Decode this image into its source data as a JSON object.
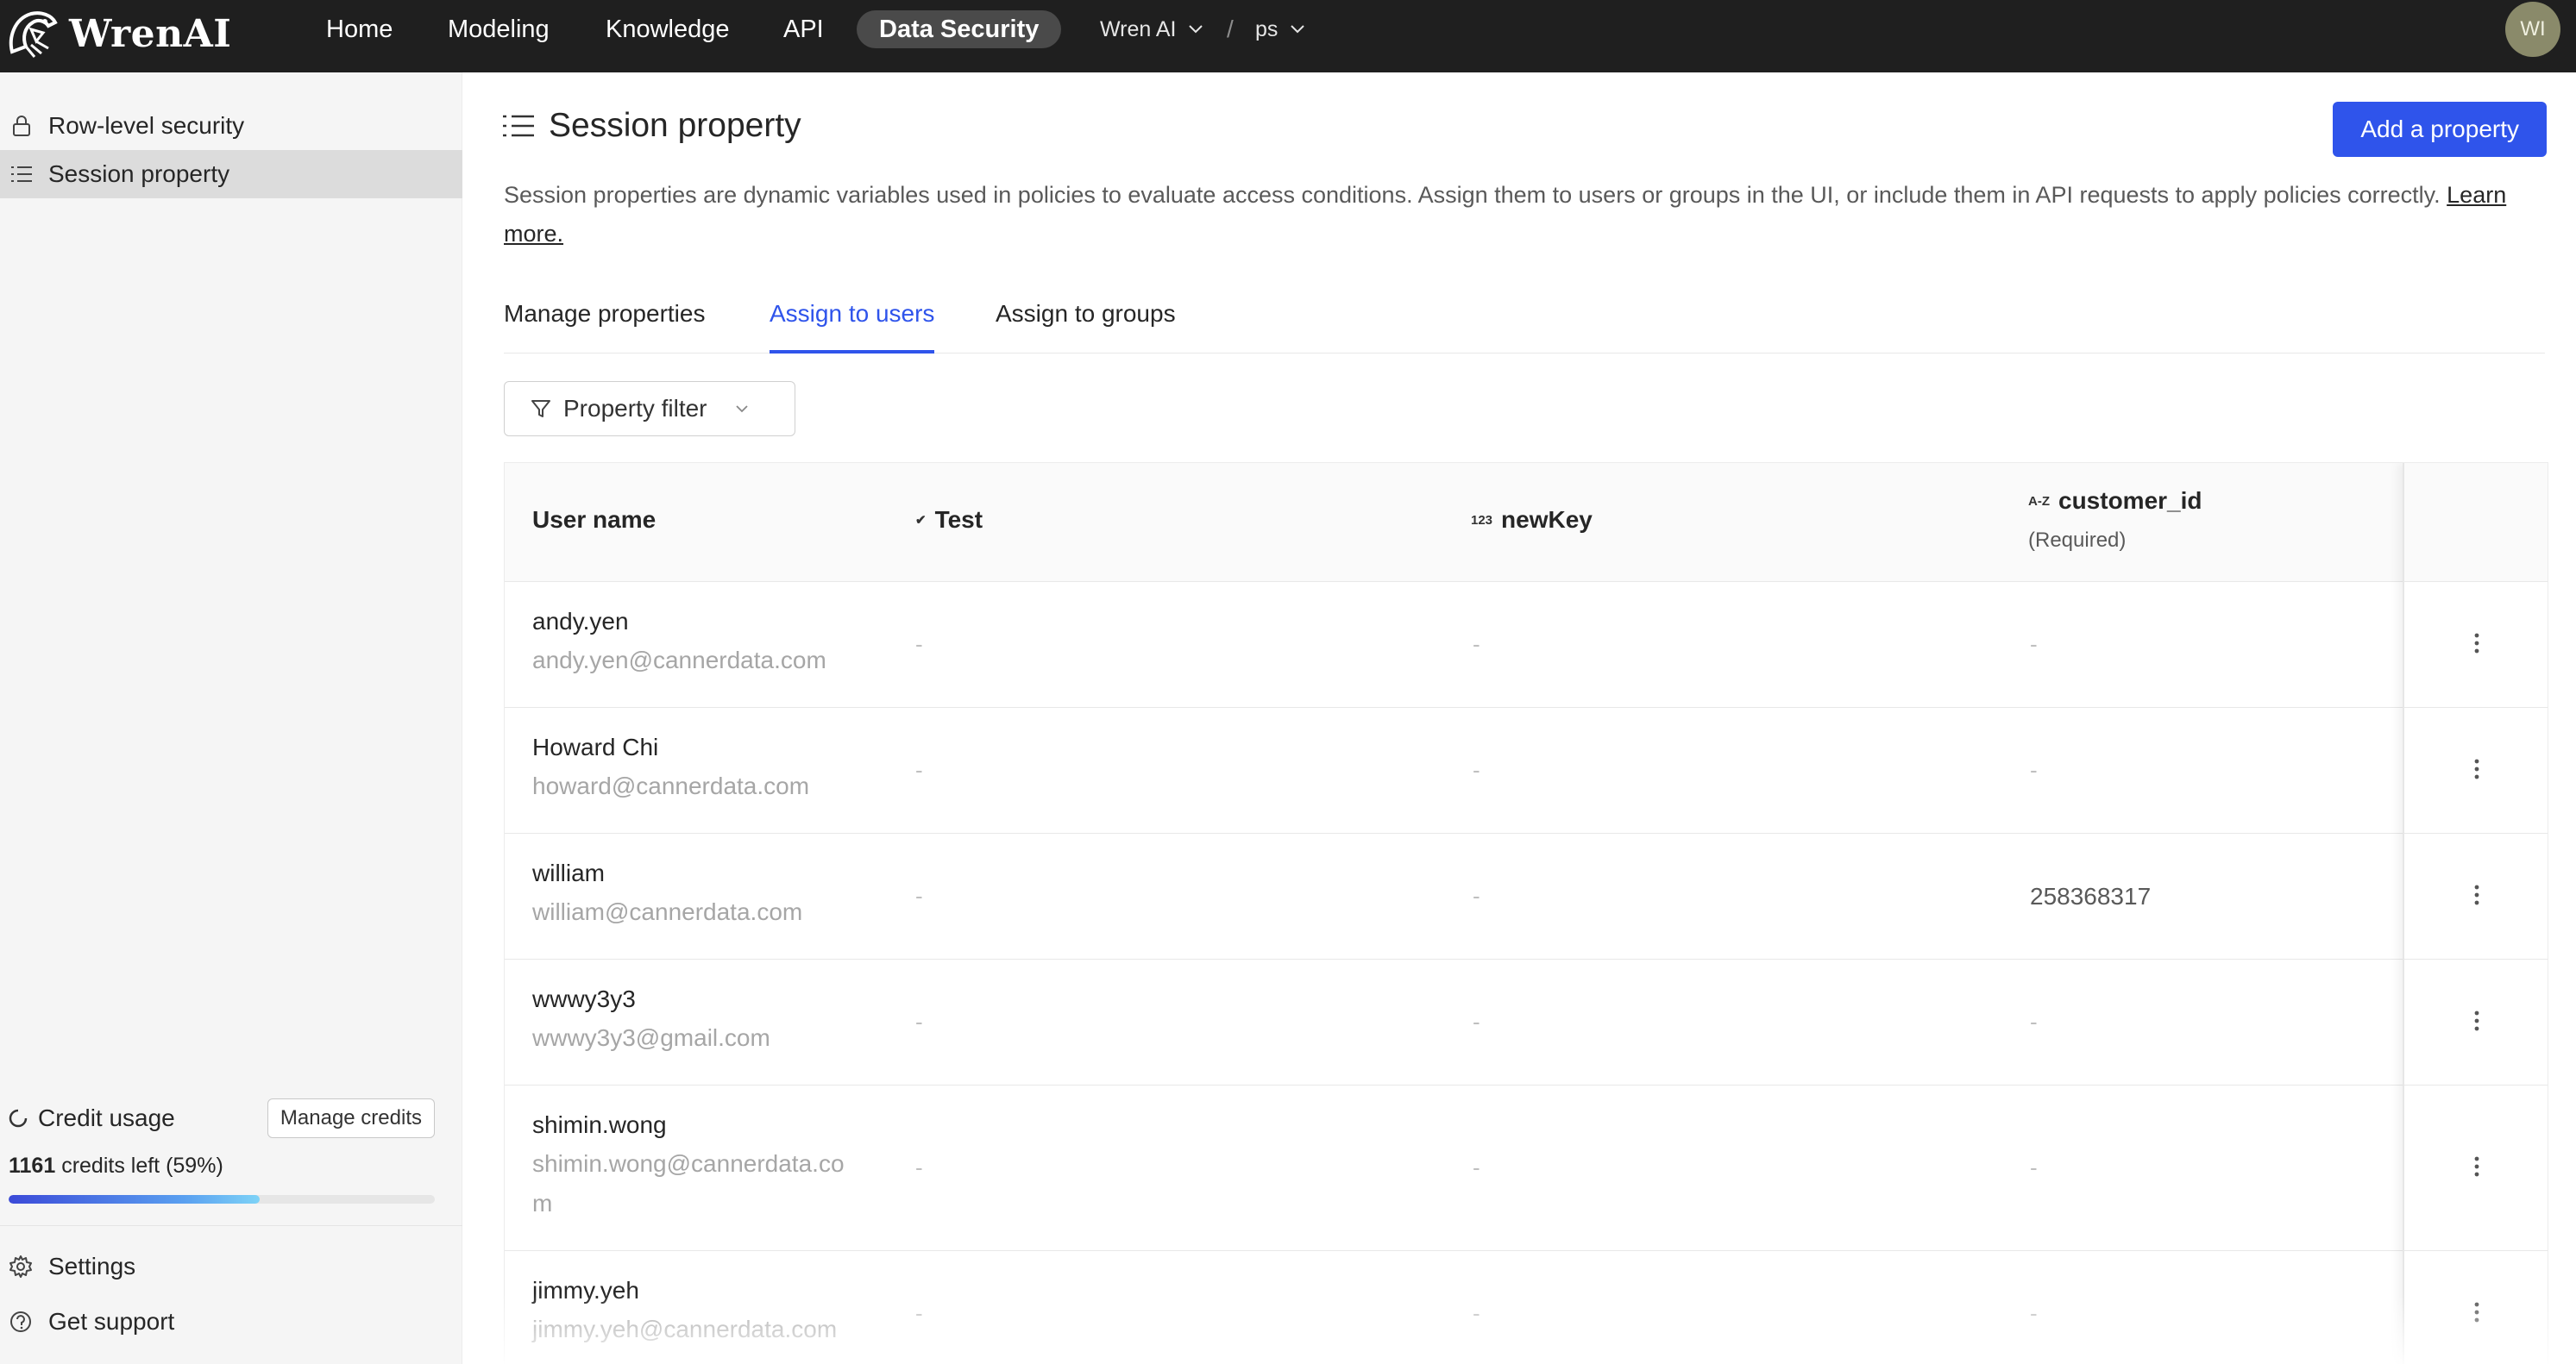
{
  "topbar": {
    "brand": "WrenAI",
    "nav": [
      "Home",
      "Modeling",
      "Knowledge",
      "API",
      "Data Security"
    ],
    "active_nav": "Data Security",
    "workspace": "Wren AI",
    "separator": "/",
    "project": "ps",
    "avatar_initials": "WI",
    "icons": [
      "wren-logo-icon",
      "chevron-down-icon"
    ]
  },
  "sidebar": {
    "items": [
      {
        "label": "Row-level security",
        "icon": "lock-icon"
      },
      {
        "label": "Session property",
        "icon": "list-icon"
      }
    ],
    "active_item": "Session property",
    "credit": {
      "label": "Credit usage",
      "manage_label": "Manage credits",
      "credits_count": "1161",
      "credits_suffix": "credits left (59%)",
      "percent_left": 59
    },
    "footer": [
      {
        "label": "Settings",
        "icon": "gear-icon"
      },
      {
        "label": "Get support",
        "icon": "help-circle-icon"
      }
    ]
  },
  "page": {
    "title": "Session property",
    "add_button": "Add a property",
    "description": "Session properties are dynamic variables used in policies to evaluate access conditions. Assign them to users or groups in the UI, or include them in API requests to apply policies correctly.",
    "learn_more": "Learn more.",
    "tabs": [
      "Manage properties",
      "Assign to users",
      "Assign to groups"
    ],
    "active_tab": "Assign to users",
    "filter_label": "Property filter"
  },
  "table": {
    "columns": [
      {
        "label": "User name",
        "type_icon": ""
      },
      {
        "label": "Test",
        "type_icon": "✔"
      },
      {
        "label": "newKey",
        "type_icon": "123"
      },
      {
        "label": "customer_id",
        "type_icon": "A-Z",
        "sub": "(Required)"
      }
    ],
    "rows": [
      {
        "name": "andy.yen",
        "email": "andy.yen@cannerdata.com",
        "test": "-",
        "newKey": "-",
        "customer_id": "-"
      },
      {
        "name": "Howard Chi",
        "email": "howard@cannerdata.com",
        "test": "-",
        "newKey": "-",
        "customer_id": "-"
      },
      {
        "name": "william",
        "email": "william@cannerdata.com",
        "test": "-",
        "newKey": "-",
        "customer_id": "258368317"
      },
      {
        "name": "wwwy3y3",
        "email": "wwwy3y3@gmail.com",
        "test": "-",
        "newKey": "-",
        "customer_id": "-"
      },
      {
        "name": "shimin.wong",
        "email": "shimin.wong@cannerdata.co m",
        "test": "-",
        "newKey": "-",
        "customer_id": "-"
      },
      {
        "name": "jimmy.yeh",
        "email": "jimmy.yeh@cannerdata.com",
        "test": "-",
        "newKey": "-",
        "customer_id": "-"
      }
    ],
    "row_action_icon": "more-vertical-icon"
  },
  "colors": {
    "topbar": "#1f1f1f",
    "accent": "#2f54eb",
    "sidebar_bg": "#f5f5f5"
  }
}
